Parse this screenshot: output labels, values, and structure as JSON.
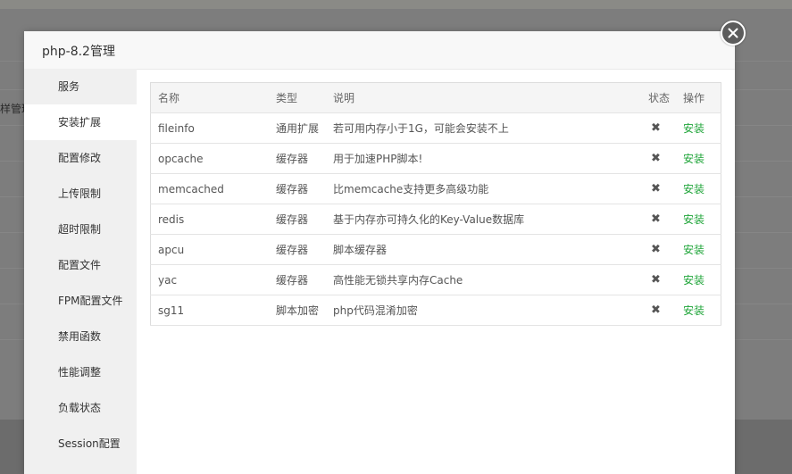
{
  "background": {
    "partial_label": "样管理"
  },
  "modal": {
    "title": "php-8.2管理",
    "close_icon": "close-icon"
  },
  "sidebar": {
    "items": [
      {
        "label": "服务"
      },
      {
        "label": "安装扩展",
        "active": true
      },
      {
        "label": "配置修改"
      },
      {
        "label": "上传限制"
      },
      {
        "label": "超时限制"
      },
      {
        "label": "配置文件"
      },
      {
        "label": "FPM配置文件"
      },
      {
        "label": "禁用函数"
      },
      {
        "label": "性能调整"
      },
      {
        "label": "负载状态"
      },
      {
        "label": "Session配置"
      }
    ]
  },
  "table": {
    "headers": {
      "name": "名称",
      "type": "类型",
      "desc": "说明",
      "status": "状态",
      "op": "操作"
    },
    "rows": [
      {
        "name": "fileinfo",
        "type": "通用扩展",
        "desc": "若可用内存小于1G，可能会安装不上",
        "status": "✖",
        "op": "安装"
      },
      {
        "name": "opcache",
        "type": "缓存器",
        "desc": "用于加速PHP脚本!",
        "status": "✖",
        "op": "安装"
      },
      {
        "name": "memcached",
        "type": "缓存器",
        "desc": "比memcache支持更多高级功能",
        "status": "✖",
        "op": "安装"
      },
      {
        "name": "redis",
        "type": "缓存器",
        "desc": "基于内存亦可持久化的Key-Value数据库",
        "status": "✖",
        "op": "安装"
      },
      {
        "name": "apcu",
        "type": "缓存器",
        "desc": "脚本缓存器",
        "status": "✖",
        "op": "安装"
      },
      {
        "name": "yac",
        "type": "缓存器",
        "desc": "高性能无锁共享内存Cache",
        "status": "✖",
        "op": "安装"
      },
      {
        "name": "sg11",
        "type": "脚本加密",
        "desc": "php代码混淆加密",
        "status": "✖",
        "op": "安装"
      }
    ]
  },
  "colors": {
    "install_link": "#20a53a",
    "sidebar_bg": "#f0f0f0",
    "overlay": "#7d7d7d"
  }
}
